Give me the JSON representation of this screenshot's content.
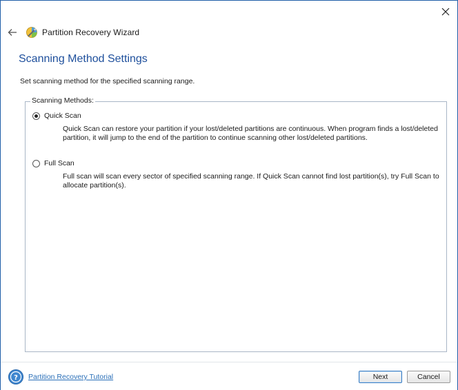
{
  "window": {
    "app_title": "Partition Recovery Wizard"
  },
  "page": {
    "title": "Scanning Method Settings",
    "description": "Set scanning method for the specified scanning range."
  },
  "scan_methods": {
    "legend": "Scanning Methods:",
    "options": [
      {
        "label": "Quick Scan",
        "selected": true,
        "description": "Quick Scan can restore your partition if your lost/deleted partitions are continuous. When program finds a lost/deleted partition, it will jump to the end of the partition to continue scanning other lost/deleted partitions."
      },
      {
        "label": "Full Scan",
        "selected": false,
        "description": "Full scan will scan every sector of specified scanning range. If Quick Scan cannot find lost partition(s), try Full Scan to allocate partition(s)."
      }
    ]
  },
  "footer": {
    "help_link": "Partition Recovery Tutorial",
    "next_label": "Next",
    "cancel_label": "Cancel"
  },
  "icons": {
    "close": "close-icon",
    "back": "back-arrow-icon",
    "app": "partition-wizard-icon",
    "help": "help-icon"
  },
  "colors": {
    "title_blue": "#1e4f9c",
    "link_blue": "#2a6fb8",
    "window_border": "#1f5ea8"
  }
}
